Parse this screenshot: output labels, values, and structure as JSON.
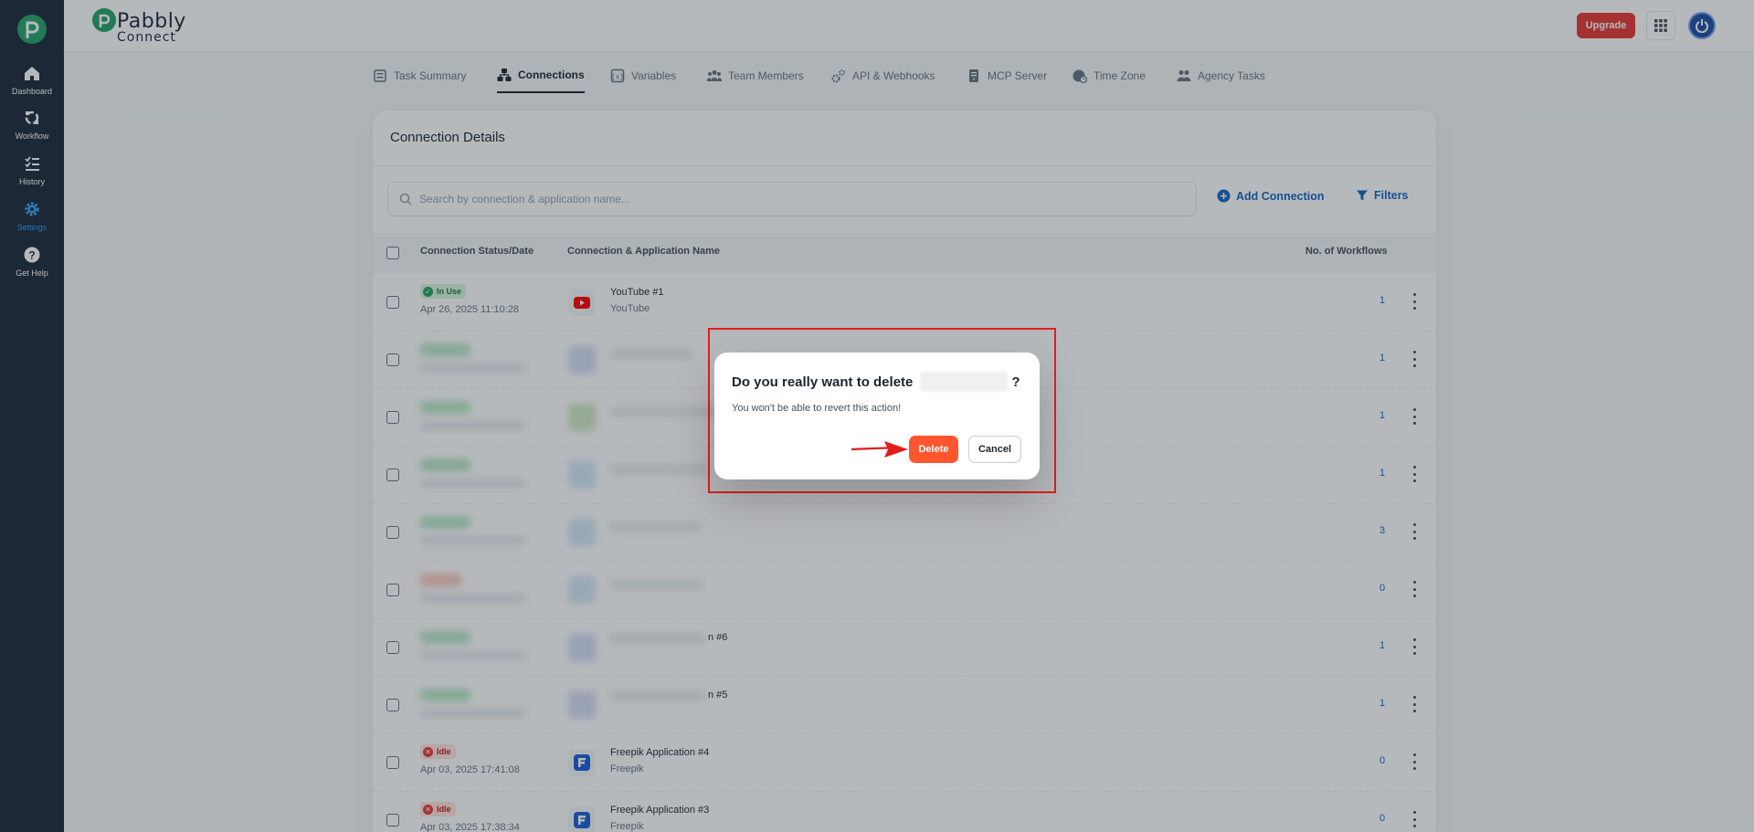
{
  "brand": {
    "name": "Pabbly",
    "sub": "Connect"
  },
  "sidebar": {
    "items": [
      {
        "label": "Dashboard",
        "icon": "home-icon"
      },
      {
        "label": "Workflow",
        "icon": "workflow-icon"
      },
      {
        "label": "History",
        "icon": "history-icon"
      },
      {
        "label": "Settings",
        "icon": "gear-icon",
        "active": true
      },
      {
        "label": "Get Help",
        "icon": "help-icon"
      }
    ]
  },
  "header": {
    "upgrade_label": "Upgrade"
  },
  "tabs": [
    {
      "label": "Task Summary"
    },
    {
      "label": "Connections",
      "active": true
    },
    {
      "label": "Variables"
    },
    {
      "label": "Team Members"
    },
    {
      "label": "API & Webhooks"
    },
    {
      "label": "MCP Server"
    },
    {
      "label": "Time Zone"
    },
    {
      "label": "Agency Tasks"
    }
  ],
  "card": {
    "title": "Connection Details",
    "search_placeholder": "Search by connection & application name...",
    "add_connection_label": "Add Connection",
    "filters_label": "Filters",
    "columns": {
      "status": "Connection Status/Date",
      "name": "Connection & Application Name",
      "workflows": "No. of Workflows"
    }
  },
  "rows": [
    {
      "status": "In Use",
      "date": "Apr 26, 2025 11:10:28",
      "name": "YouTube #1",
      "app": "YouTube",
      "workflows": "1"
    },
    {
      "status": "",
      "date": "",
      "name": "",
      "app": "",
      "workflows": "1"
    },
    {
      "status": "",
      "date": "",
      "name": "",
      "app": "",
      "workflows": "1"
    },
    {
      "status": "",
      "date": "",
      "name": "",
      "app": "",
      "workflows": "1"
    },
    {
      "status": "",
      "date": "",
      "name": "",
      "app": "",
      "workflows": "3"
    },
    {
      "status": "",
      "date": "",
      "name": "",
      "app": "",
      "workflows": "0"
    },
    {
      "status": "",
      "date": "",
      "name": "n #6",
      "app": "",
      "workflows": "1"
    },
    {
      "status": "",
      "date": "",
      "name": "n #5",
      "app": "",
      "workflows": "1"
    },
    {
      "status": "Idle",
      "date": "Apr 03, 2025 17:41:08",
      "name": "Freepik Application #4",
      "app": "Freepik",
      "workflows": "0"
    },
    {
      "status": "Idle",
      "date": "Apr 03, 2025 17:38:34",
      "name": "Freepik Application #3",
      "app": "Freepik",
      "workflows": "0"
    }
  ],
  "dialog": {
    "title_prefix": "Do you really want to delete",
    "title_suffix": "?",
    "message": "You won't be able to revert this action!",
    "delete_label": "Delete",
    "cancel_label": "Cancel"
  },
  "colors": {
    "accent": "#1565c0",
    "danger": "#ff5630",
    "sidebar": "#1c2a3a",
    "brand_green": "#26a269"
  }
}
